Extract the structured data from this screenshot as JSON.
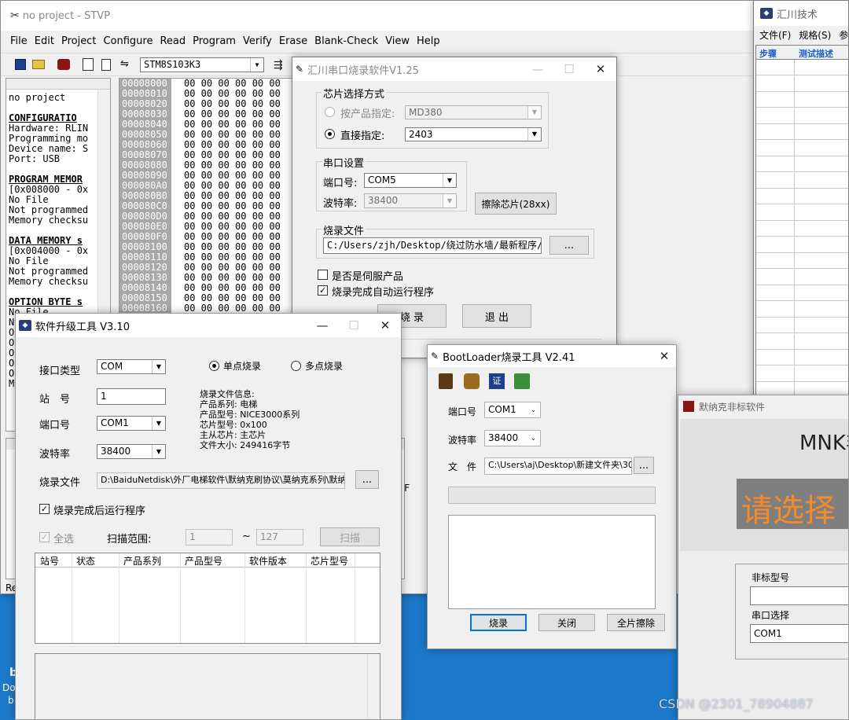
{
  "stvp": {
    "title": "no project - STVP",
    "menu": [
      "File",
      "Edit",
      "Project",
      "Configure",
      "Read",
      "Program",
      "Verify",
      "Erase",
      "Blank-Check",
      "View",
      "Help"
    ],
    "device": "STM8S103K3",
    "left_lines": [
      "no project",
      "",
      "CONFIGURATIO",
      "Hardware: RLIN",
      "Programming mo",
      "Device name: S",
      "Port: USB",
      "",
      "PROGRAM MEMOR",
      "[0x008000 - 0x",
      "No File",
      "Not programmed",
      "Memory checksu",
      "",
      "DATA MEMORY s",
      "[0x004000 - 0x",
      "No File",
      "Not programmed",
      "Memory checksu",
      "",
      "OPTION BYTE s",
      "No File",
      "N",
      "O",
      "O",
      "O",
      "O",
      "O",
      "M"
    ],
    "addresses": [
      "00008000",
      "00008010",
      "00008020",
      "00008030",
      "00008040",
      "00008050",
      "00008060",
      "00008070",
      "00008080",
      "00008090",
      "000080A0",
      "000080B0",
      "000080C0",
      "000080D0",
      "000080E0",
      "000080F0",
      "00008100",
      "00008110",
      "00008120",
      "00008130",
      "00008140",
      "00008150",
      "00008160"
    ],
    "hex_row": "00 00 00 00 00 00",
    "bottom_left": "Re",
    "bottom_frag": "F"
  },
  "huichuan_tech": {
    "title": "汇川技术",
    "menu": [
      "文件(F)",
      "规格(S)",
      "参"
    ],
    "col1": "步骤",
    "col2": "测试描述"
  },
  "huichuan_burner": {
    "title": "汇川串口烧录软件V1.25",
    "chip_group": "芯片选择方式",
    "by_product_label": "按产品指定:",
    "by_product_value": "MD380",
    "direct_label": "直接指定:",
    "direct_value": "2403",
    "serial_group": "串口设置",
    "port_label": "端口号:",
    "port_value": "COM5",
    "baud_label": "波特率:",
    "baud_value": "38400",
    "erase_button": "擦除芯片(28xx)",
    "file_group": "烧录文件",
    "file_path": "C:/Users/zjh/Desktop/绕过防水墙/最新程序/",
    "browse": "...",
    "servo_check": "是否是伺服产品",
    "auto_run_check": "烧录完成自动运行程序",
    "burn_button": "烧 录",
    "exit_button": "退 出"
  },
  "upgrade_tool": {
    "title": "软件升级工具 V3.10",
    "iface_label": "接口类型",
    "iface_value": "COM",
    "single": "单点烧录",
    "multi": "多点烧录",
    "station_label": "站　号",
    "station_value": "1",
    "port_label": "端口号",
    "port_value": "COM1",
    "baud_label": "波特率",
    "baud_value": "38400",
    "info_lines": [
      "烧录文件信息:",
      "产品系列: 电梯",
      "产品型号: NICE3000系列",
      "芯片型号: 0x100",
      "主从芯片: 主芯片",
      "文件大小: 249416字节"
    ],
    "file_label": "烧录文件",
    "file_path": "D:\\BaiduNetdisk\\外厂电梯软件\\默纳克刷协议\\莫纳克系列\\默纳",
    "browse": "...",
    "auto_run": "烧录完成后运行程序",
    "select_all": "全选",
    "scan_range": "扫描范围:",
    "range_from": "1",
    "range_sep": "~",
    "range_to": "127",
    "scan_button": "扫描",
    "columns": [
      "站号",
      "状态",
      "产品系列",
      "产品型号",
      "软件版本",
      "芯片型号"
    ]
  },
  "bootloader": {
    "title": "BootLoader烧录工具 V2.41",
    "port_label": "端口号",
    "port_value": "COM1",
    "baud_label": "波特率",
    "baud_value": "38400",
    "file_label": "文　件",
    "file_path": "C:\\Users\\aj\\Desktop\\新建文件夹\\300",
    "browse": "...",
    "burn_button": "烧录",
    "close_button": "关闭",
    "erase_all_button": "全片擦除"
  },
  "monarch": {
    "title": "默纳克非标软件",
    "brand": "MNK非",
    "prompt": "请选择",
    "model_label": "非标型号",
    "port_label": "串口选择",
    "port_value": "COM1"
  },
  "desktop": {
    "watermark": "CSDN @2301_78904887",
    "frag_a": "b",
    "frag_b": "Do",
    "frag_c": "b"
  },
  "colors": {
    "desktop": "#1d79c9",
    "orange_text": "#f48a2a",
    "monarch_gray": "#7f7f7f"
  }
}
